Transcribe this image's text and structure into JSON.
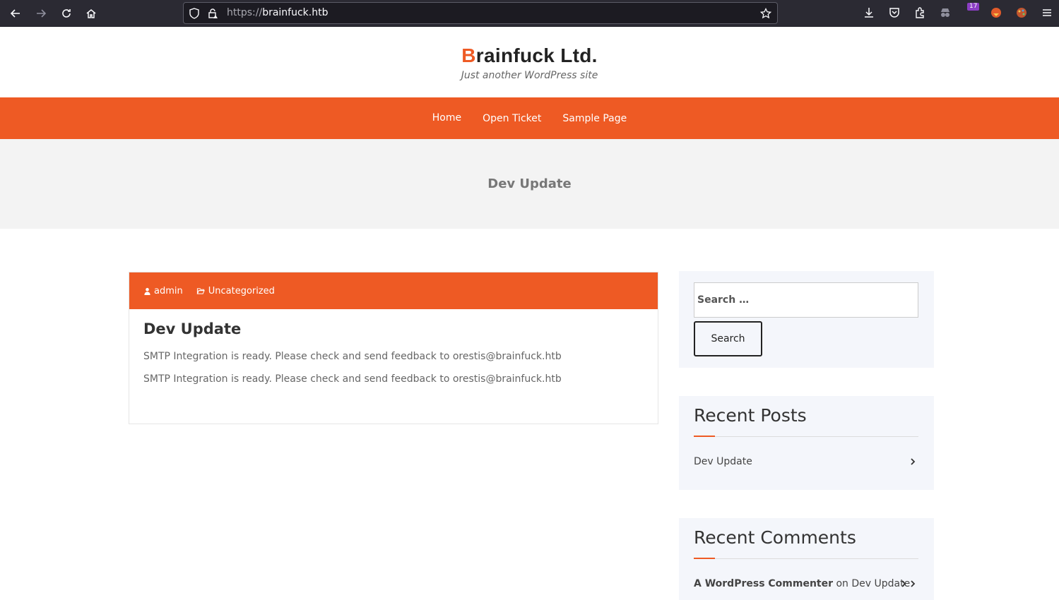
{
  "browser": {
    "url_protocol": "https://",
    "url_host": "brainfuck.htb",
    "badge_count": "17"
  },
  "site": {
    "title_first": "B",
    "title_rest": "rainfuck Ltd.",
    "tagline": "Just another WordPress site",
    "accent_color": "#ee5a24"
  },
  "menu": {
    "items": [
      "Home",
      "Open Ticket",
      "Sample Page"
    ]
  },
  "banner": {
    "title": "Dev Update"
  },
  "post": {
    "author": "admin",
    "category": "Uncategorized",
    "title": "Dev Update",
    "paragraphs": [
      "SMTP Integration is ready. Please check and send feedback to orestis@brainfuck.htb",
      "SMTP Integration is ready. Please check and send feedback to orestis@brainfuck.htb"
    ]
  },
  "sidebar": {
    "search_placeholder": "Search …",
    "search_button": "Search",
    "recent_posts_title": "Recent Posts",
    "recent_posts": [
      "Dev Update"
    ],
    "recent_comments_title": "Recent Comments",
    "recent_comment": {
      "author": "A WordPress Commenter",
      "on": "on",
      "post": "Dev Update"
    }
  }
}
